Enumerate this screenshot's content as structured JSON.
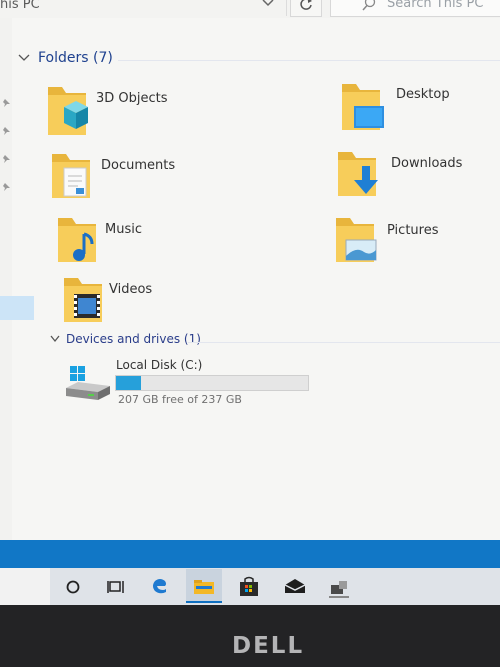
{
  "window": {
    "address_text": "his PC"
  },
  "search": {
    "placeholder": "Search This PC"
  },
  "folders_section": {
    "header": "Folders (7)",
    "items": [
      {
        "label": "3D Objects",
        "icon": "3d-objects-folder-icon"
      },
      {
        "label": "Desktop",
        "icon": "desktop-folder-icon"
      },
      {
        "label": "Documents",
        "icon": "documents-folder-icon"
      },
      {
        "label": "Downloads",
        "icon": "downloads-folder-icon"
      },
      {
        "label": "Music",
        "icon": "music-folder-icon"
      },
      {
        "label": "Pictures",
        "icon": "pictures-folder-icon"
      },
      {
        "label": "Videos",
        "icon": "videos-folder-icon"
      }
    ]
  },
  "drives_section": {
    "header": "Devices and drives (1)",
    "drives": [
      {
        "label": "Local Disk (C:)",
        "free_text": "207 GB free of 237 GB",
        "used_fraction": 0.13,
        "icon": "windows-drive-icon"
      }
    ]
  },
  "taskbar": {
    "items": [
      "cortana-circle-icon",
      "task-view-icon",
      "edge-icon",
      "file-explorer-icon",
      "store-icon",
      "mail-icon",
      "app-icon"
    ]
  },
  "bezel": {
    "brand": "DELL"
  },
  "colors": {
    "accent": "#1e3287",
    "taskbar_blue": "#1177c6",
    "drive_fill": "#26a0da"
  }
}
